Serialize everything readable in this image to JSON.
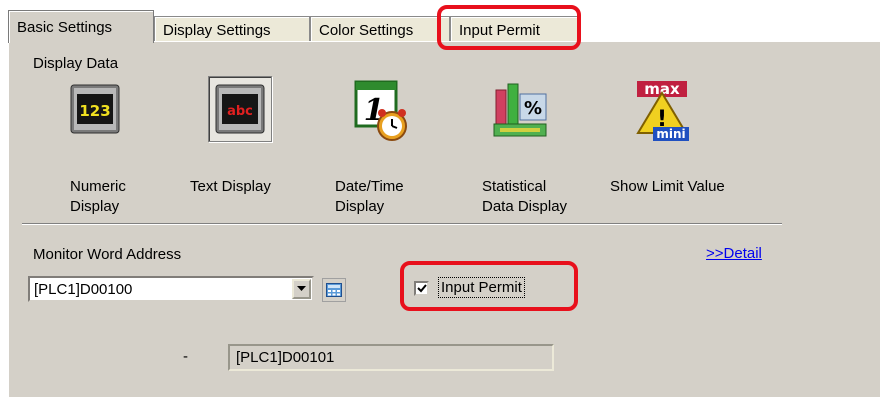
{
  "tabs": [
    {
      "label": "Basic Settings",
      "active": true
    },
    {
      "label": "Display Settings",
      "active": false
    },
    {
      "label": "Color Settings",
      "active": false
    },
    {
      "label": "Input Permit",
      "active": false
    }
  ],
  "display_data": {
    "heading": "Display Data",
    "options": [
      {
        "label": "Numeric Display",
        "label_lines": [
          "Numeric",
          "Display"
        ],
        "icon": "numeric-display-icon",
        "icon_text": "123",
        "selected": false
      },
      {
        "label": "Text Display",
        "label_lines": [
          "Text Display"
        ],
        "icon": "text-display-icon",
        "icon_text": "abc",
        "selected": true
      },
      {
        "label": "Date/Time Display",
        "label_lines": [
          "Date/Time",
          "Display"
        ],
        "icon": "date-time-display-icon",
        "icon_text": "1",
        "selected": false
      },
      {
        "label": "Statistical Data Display",
        "label_lines": [
          "Statistical",
          "Data Display"
        ],
        "icon": "statistical-data-display-icon",
        "icon_text": "%",
        "selected": false
      },
      {
        "label": "Show Limit Value",
        "label_lines": [
          "Show Limit Value"
        ],
        "icon": "show-limit-value-icon",
        "icon_text_top": "max",
        "icon_text_mid": "!",
        "icon_text_bottom": "mini",
        "selected": false
      }
    ]
  },
  "monitor": {
    "label": "Monitor Word Address",
    "address": "[PLC1]D00100",
    "detail_link": ">>Detail",
    "input_permit_label": "Input Permit",
    "input_permit_checked": true,
    "dash": "-",
    "second_address": "[PLC1]D00101"
  },
  "colors": {
    "panel": "#d4d0c8",
    "highlight": "#e8101c",
    "link": "#0000ee"
  }
}
